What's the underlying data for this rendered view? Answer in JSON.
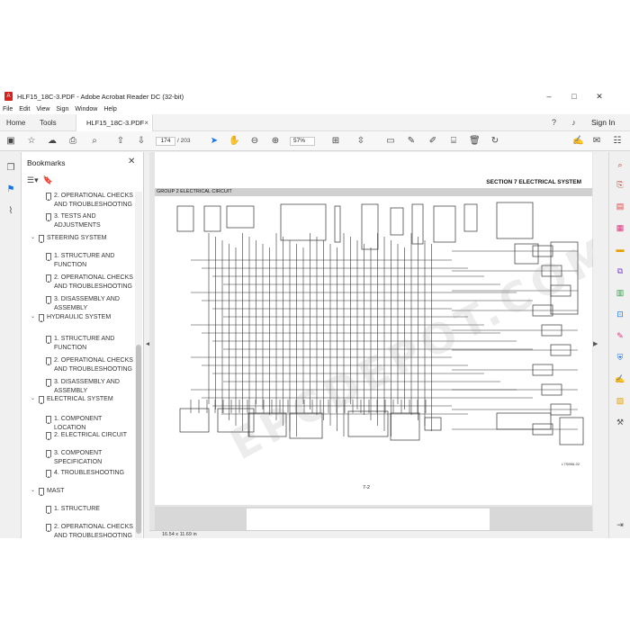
{
  "window": {
    "title": "HLF15_18C-3.PDF - Adobe Acrobat Reader DC (32-bit)",
    "minimize": "–",
    "maximize": "□",
    "close": "✕"
  },
  "menu": [
    "File",
    "Edit",
    "View",
    "Sign",
    "Window",
    "Help"
  ],
  "tabs": {
    "home": "Home",
    "tools": "Tools",
    "document": "HLF15_18C-3.PDF",
    "close": "×",
    "signin": "Sign In"
  },
  "toolbar": {
    "page_current": "174",
    "page_total": "/ 203",
    "zoom": "57%"
  },
  "bookmarks": {
    "header": "Bookmarks",
    "close": "✕",
    "items": [
      {
        "label": "2. OPERATIONAL CHECKS AND TROUBLESHOOTING",
        "level": 2
      },
      {
        "label": "3. TESTS AND ADJUSTMENTS",
        "level": 2
      },
      {
        "label": "STEERING SYSTEM",
        "level": 1
      },
      {
        "label": "1. STRUCTURE AND FUNCTION",
        "level": 2
      },
      {
        "label": "2. OPERATIONAL CHECKS AND TROUBLESHOOTING",
        "level": 2
      },
      {
        "label": "3. DISASSEMBLY AND ASSEMBLY",
        "level": 2
      },
      {
        "label": "HYDRAULIC SYSTEM",
        "level": 1
      },
      {
        "label": "1. STRUCTURE AND FUNCTION",
        "level": 2
      },
      {
        "label": "2. OPERATIONAL CHECKS AND TROUBLESHOOTING",
        "level": 2
      },
      {
        "label": "3. DISASSEMBLY AND ASSEMBLY",
        "level": 2
      },
      {
        "label": "ELECTRICAL SYSTEM",
        "level": 1
      },
      {
        "label": "1. COMPONENT LOCATION",
        "level": 2
      },
      {
        "label": "2. ELECTRICAL CIRCUIT",
        "level": 2
      },
      {
        "label": "3. COMPONENT SPECIFICATION",
        "level": 2
      },
      {
        "label": "4. TROUBLESHOOTING",
        "level": 2
      },
      {
        "label": "MAST",
        "level": 1
      },
      {
        "label": "1. STRUCTURE",
        "level": 2
      },
      {
        "label": "2. OPERATIONAL CHECKS AND TROUBLESHOOTING",
        "level": 2
      }
    ]
  },
  "document": {
    "section_title": "SECTION 7  ELECTRICAL  SYSTEM",
    "group_title": "GROUP 2  ELECTRICAL CIRCUIT",
    "page_number": "7-2",
    "diagram_code": "L7S0B6-02",
    "watermark": "EPCDEPOT.COM"
  },
  "status": {
    "page_size": "16.54 x 11.69 in"
  }
}
